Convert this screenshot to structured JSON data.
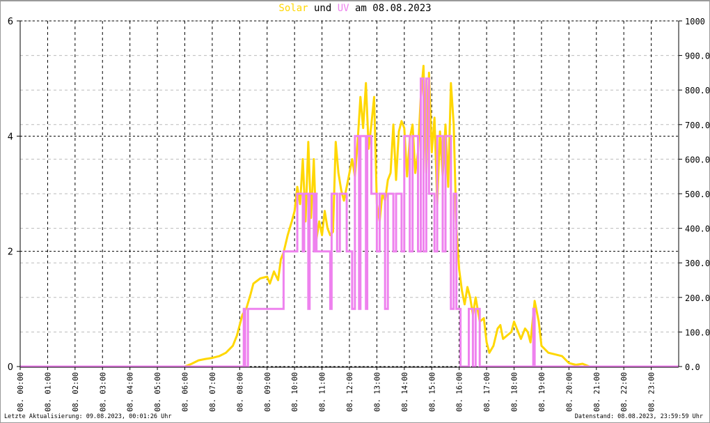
{
  "title": {
    "part1": "Solar",
    "part2": " und ",
    "part3": "UV",
    "part4": " am 08.08.2023"
  },
  "footer": {
    "left": "Letzte Aktualisierung: 09.08.2023, 00:01:26 Uhr",
    "right": "Datenstand: 08.08.2023, 23:59:59 Uhr"
  },
  "chart_data": {
    "type": "line",
    "colors": {
      "solar": "#FFD700",
      "uv": "#EE82EE",
      "grid_major": "#000000",
      "grid_minor": "#BBBBBB"
    },
    "x_range_hours": [
      0,
      24
    ],
    "x_tick_labels": [
      "08. 00:00",
      "08. 01:00",
      "08. 02:00",
      "08. 03:00",
      "08. 04:00",
      "08. 05:00",
      "08. 06:00",
      "08. 07:00",
      "08. 08:00",
      "08. 09:00",
      "08. 10:00",
      "08. 11:00",
      "08. 12:00",
      "08. 13:00",
      "08. 14:00",
      "08. 15:00",
      "08. 16:00",
      "08. 17:00",
      "08. 18:00",
      "08. 19:00",
      "08. 20:00",
      "08. 21:00",
      "08. 22:00",
      "08. 23:00"
    ],
    "y_left": {
      "range": [
        0,
        6
      ],
      "ticks": [
        "0",
        "2",
        "4",
        "6"
      ],
      "series": "UV"
    },
    "y_right": {
      "range": [
        0,
        1000
      ],
      "ticks": [
        "0.0",
        "100.0",
        "200.0",
        "300.0",
        "400.0",
        "500.0",
        "600.0",
        "700.0",
        "800.0",
        "900.0",
        "1000"
      ],
      "series": "Solar"
    },
    "grid": true,
    "series": [
      {
        "name": "Solar",
        "axis": "right",
        "points": [
          [
            0,
            0
          ],
          [
            6.0,
            0
          ],
          [
            6.25,
            8
          ],
          [
            6.5,
            18
          ],
          [
            6.75,
            22
          ],
          [
            7.0,
            25
          ],
          [
            7.25,
            30
          ],
          [
            7.5,
            40
          ],
          [
            7.75,
            60
          ],
          [
            7.9,
            90
          ],
          [
            8.0,
            120
          ],
          [
            8.1,
            150
          ],
          [
            8.25,
            170
          ],
          [
            8.4,
            210
          ],
          [
            8.5,
            240
          ],
          [
            8.75,
            255
          ],
          [
            9.0,
            260
          ],
          [
            9.1,
            240
          ],
          [
            9.25,
            275
          ],
          [
            9.4,
            250
          ],
          [
            9.5,
            310
          ],
          [
            9.6,
            330
          ],
          [
            9.75,
            380
          ],
          [
            9.9,
            420
          ],
          [
            10.0,
            450
          ],
          [
            10.1,
            520
          ],
          [
            10.2,
            470
          ],
          [
            10.3,
            600
          ],
          [
            10.4,
            420
          ],
          [
            10.5,
            650
          ],
          [
            10.6,
            430
          ],
          [
            10.7,
            600
          ],
          [
            10.8,
            370
          ],
          [
            10.9,
            420
          ],
          [
            11.0,
            380
          ],
          [
            11.1,
            450
          ],
          [
            11.2,
            400
          ],
          [
            11.3,
            380
          ],
          [
            11.4,
            390
          ],
          [
            11.5,
            650
          ],
          [
            11.6,
            560
          ],
          [
            11.7,
            510
          ],
          [
            11.8,
            480
          ],
          [
            11.9,
            520
          ],
          [
            12.0,
            560
          ],
          [
            12.1,
            600
          ],
          [
            12.2,
            550
          ],
          [
            12.3,
            650
          ],
          [
            12.4,
            780
          ],
          [
            12.5,
            690
          ],
          [
            12.6,
            820
          ],
          [
            12.7,
            630
          ],
          [
            12.8,
            700
          ],
          [
            12.9,
            780
          ],
          [
            13.0,
            470
          ],
          [
            13.1,
            420
          ],
          [
            13.2,
            500
          ],
          [
            13.3,
            480
          ],
          [
            13.4,
            540
          ],
          [
            13.5,
            560
          ],
          [
            13.6,
            700
          ],
          [
            13.7,
            540
          ],
          [
            13.8,
            680
          ],
          [
            13.9,
            710
          ],
          [
            14.0,
            690
          ],
          [
            14.1,
            550
          ],
          [
            14.2,
            660
          ],
          [
            14.3,
            700
          ],
          [
            14.4,
            560
          ],
          [
            14.5,
            620
          ],
          [
            14.6,
            780
          ],
          [
            14.7,
            870
          ],
          [
            14.8,
            560
          ],
          [
            14.9,
            850
          ],
          [
            15.0,
            620
          ],
          [
            15.1,
            720
          ],
          [
            15.2,
            470
          ],
          [
            15.3,
            680
          ],
          [
            15.4,
            550
          ],
          [
            15.5,
            700
          ],
          [
            15.6,
            520
          ],
          [
            15.7,
            820
          ],
          [
            15.8,
            700
          ],
          [
            15.9,
            400
          ],
          [
            16.0,
            280
          ],
          [
            16.1,
            220
          ],
          [
            16.2,
            180
          ],
          [
            16.3,
            230
          ],
          [
            16.4,
            200
          ],
          [
            16.5,
            150
          ],
          [
            16.6,
            200
          ],
          [
            16.75,
            130
          ],
          [
            16.9,
            140
          ],
          [
            17.0,
            70
          ],
          [
            17.1,
            40
          ],
          [
            17.25,
            60
          ],
          [
            17.4,
            110
          ],
          [
            17.5,
            120
          ],
          [
            17.6,
            80
          ],
          [
            17.75,
            90
          ],
          [
            17.9,
            100
          ],
          [
            18.0,
            130
          ],
          [
            18.1,
            110
          ],
          [
            18.25,
            80
          ],
          [
            18.4,
            110
          ],
          [
            18.5,
            100
          ],
          [
            18.6,
            70
          ],
          [
            18.75,
            190
          ],
          [
            18.9,
            130
          ],
          [
            19.0,
            60
          ],
          [
            19.25,
            40
          ],
          [
            19.5,
            35
          ],
          [
            19.75,
            30
          ],
          [
            20.0,
            10
          ],
          [
            20.25,
            5
          ],
          [
            20.5,
            8
          ],
          [
            20.75,
            0
          ],
          [
            24,
            0
          ]
        ]
      },
      {
        "name": "UV",
        "axis": "left",
        "step": true,
        "points": [
          [
            0,
            0
          ],
          [
            8.15,
            0
          ],
          [
            8.15,
            1
          ],
          [
            8.2,
            1
          ],
          [
            8.2,
            0
          ],
          [
            8.3,
            0
          ],
          [
            8.3,
            1
          ],
          [
            9.6,
            1
          ],
          [
            9.6,
            2
          ],
          [
            10.1,
            2
          ],
          [
            10.1,
            3
          ],
          [
            10.3,
            3
          ],
          [
            10.3,
            2
          ],
          [
            10.35,
            2
          ],
          [
            10.35,
            3
          ],
          [
            10.5,
            3
          ],
          [
            10.5,
            1
          ],
          [
            10.55,
            1
          ],
          [
            10.55,
            3
          ],
          [
            10.7,
            3
          ],
          [
            10.7,
            2
          ],
          [
            10.75,
            2
          ],
          [
            10.75,
            3
          ],
          [
            10.8,
            3
          ],
          [
            10.8,
            2
          ],
          [
            11.3,
            2
          ],
          [
            11.3,
            1
          ],
          [
            11.35,
            1
          ],
          [
            11.35,
            3
          ],
          [
            11.55,
            3
          ],
          [
            11.55,
            2
          ],
          [
            11.65,
            2
          ],
          [
            11.65,
            3
          ],
          [
            11.9,
            3
          ],
          [
            11.9,
            2
          ],
          [
            12.1,
            2
          ],
          [
            12.1,
            1
          ],
          [
            12.2,
            1
          ],
          [
            12.2,
            4
          ],
          [
            12.35,
            4
          ],
          [
            12.35,
            1
          ],
          [
            12.4,
            1
          ],
          [
            12.4,
            4
          ],
          [
            12.6,
            4
          ],
          [
            12.6,
            1
          ],
          [
            12.65,
            1
          ],
          [
            12.65,
            4
          ],
          [
            12.8,
            4
          ],
          [
            12.8,
            3
          ],
          [
            13.0,
            3
          ],
          [
            13.0,
            2
          ],
          [
            13.1,
            2
          ],
          [
            13.1,
            3
          ],
          [
            13.3,
            3
          ],
          [
            13.3,
            1
          ],
          [
            13.4,
            1
          ],
          [
            13.4,
            3
          ],
          [
            13.6,
            3
          ],
          [
            13.6,
            2
          ],
          [
            13.7,
            2
          ],
          [
            13.7,
            3
          ],
          [
            13.9,
            3
          ],
          [
            13.9,
            2
          ],
          [
            14.0,
            2
          ],
          [
            14.0,
            4
          ],
          [
            14.2,
            4
          ],
          [
            14.2,
            2
          ],
          [
            14.3,
            2
          ],
          [
            14.3,
            4
          ],
          [
            14.5,
            4
          ],
          [
            14.5,
            2
          ],
          [
            14.6,
            2
          ],
          [
            14.6,
            5
          ],
          [
            14.7,
            5
          ],
          [
            14.7,
            2
          ],
          [
            14.8,
            2
          ],
          [
            14.8,
            5
          ],
          [
            14.9,
            5
          ],
          [
            14.9,
            3
          ],
          [
            15.1,
            3
          ],
          [
            15.1,
            2
          ],
          [
            15.2,
            2
          ],
          [
            15.2,
            4
          ],
          [
            15.4,
            4
          ],
          [
            15.4,
            2
          ],
          [
            15.5,
            2
          ],
          [
            15.5,
            4
          ],
          [
            15.7,
            4
          ],
          [
            15.7,
            1
          ],
          [
            15.8,
            1
          ],
          [
            15.8,
            3
          ],
          [
            15.9,
            3
          ],
          [
            15.9,
            1
          ],
          [
            16.05,
            1
          ],
          [
            16.05,
            0
          ],
          [
            16.35,
            0
          ],
          [
            16.35,
            1
          ],
          [
            16.5,
            1
          ],
          [
            16.5,
            0
          ],
          [
            16.6,
            0
          ],
          [
            16.6,
            1
          ],
          [
            16.75,
            1
          ],
          [
            16.75,
            0
          ],
          [
            18.7,
            0
          ],
          [
            18.7,
            1
          ],
          [
            18.75,
            1
          ],
          [
            18.75,
            0
          ],
          [
            24,
            0
          ]
        ]
      }
    ]
  }
}
